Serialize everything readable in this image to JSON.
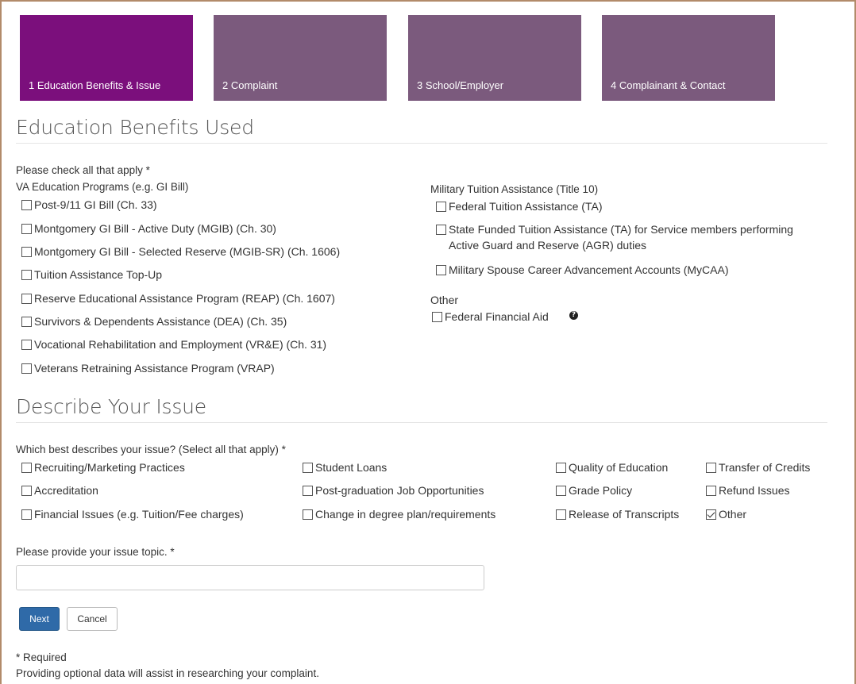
{
  "steps": [
    {
      "label": "1 Education Benefits & Issue",
      "active": true
    },
    {
      "label": "2 Complaint",
      "active": false
    },
    {
      "label": "3 School/Employer",
      "active": false
    },
    {
      "label": "4 Complainant & Contact",
      "active": false
    }
  ],
  "benefits": {
    "heading": "Education Benefits Used",
    "instruction": "Please check all that apply *",
    "va_group_label": "VA Education Programs (e.g. GI Bill)",
    "va_items": [
      "Post-9/11 GI Bill (Ch. 33)",
      "Montgomery GI Bill - Active Duty (MGIB) (Ch. 30)",
      "Montgomery GI Bill - Selected Reserve (MGIB-SR) (Ch. 1606)",
      "Tuition Assistance Top-Up",
      "Reserve Educational Assistance Program (REAP) (Ch. 1607)",
      "Survivors & Dependents Assistance (DEA) (Ch. 35)",
      "Vocational Rehabilitation and Employment (VR&E) (Ch. 31)",
      "Veterans Retraining Assistance Program (VRAP)"
    ],
    "military_group_label": "Military Tuition Assistance (Title 10)",
    "military_items": [
      "Federal Tuition Assistance (TA)",
      "State Funded Tuition Assistance (TA) for Service members performing",
      "Active Guard and Reserve (AGR) duties",
      "Military Spouse Career Advancement Accounts (MyCAA)"
    ],
    "other_group_label": "Other",
    "other_items": [
      "Federal Financial Aid"
    ],
    "help_icon": "question-circle-icon"
  },
  "issue": {
    "heading": "Describe Your Issue",
    "instruction": "Which best describes your issue? (Select all that apply) *",
    "col1": [
      "Recruiting/Marketing Practices",
      "Accreditation",
      "Financial Issues (e.g. Tuition/Fee charges)"
    ],
    "col2": [
      "Student Loans",
      "Post-graduation Job Opportunities",
      "Change in degree plan/requirements"
    ],
    "col3": [
      "Quality of Education",
      "Grade Policy",
      "Release of Transcripts"
    ],
    "col4": [
      "Transfer of Credits",
      "Refund Issues",
      "Other"
    ],
    "checked": [
      "Other"
    ],
    "topic_label": "Please provide your issue topic. *",
    "topic_value": ""
  },
  "buttons": {
    "next": "Next",
    "cancel": "Cancel"
  },
  "footer": {
    "required_note": "* Required",
    "optional_note": "Providing optional data will assist in researching your complaint."
  },
  "colors": {
    "active_step": "#7b0f7c",
    "inactive_step": "#7b5a7d",
    "primary_button": "#2f6aa8"
  }
}
